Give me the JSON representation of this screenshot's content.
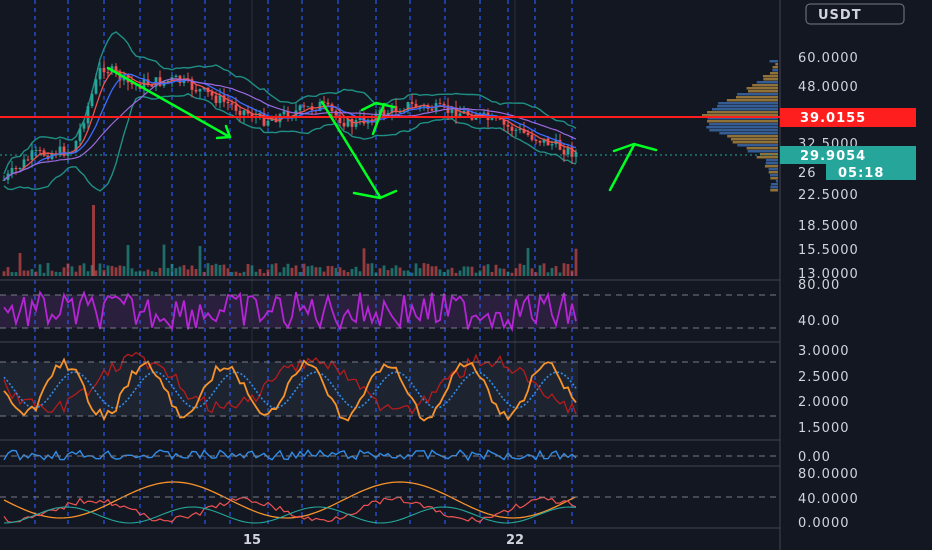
{
  "currency_label": "USDT",
  "price_axis": [
    "60.0000",
    "48.0000",
    "32.5000",
    "26",
    "22.5000",
    "18.5000",
    "15.5000",
    "13.0000"
  ],
  "rsi_axis": [
    "80.00",
    "40.00"
  ],
  "stoch_axis": [
    "3.0000",
    "2.5000",
    "2.0000",
    "1.5000"
  ],
  "mid_axis": [
    "0.00"
  ],
  "dmi_axis": [
    "80.0000",
    "40.0000",
    "0.0000"
  ],
  "badges": {
    "red_price": "39.0155",
    "current_price": "29.9054",
    "countdown": "05:18"
  },
  "date_labels": [
    "15",
    "22"
  ],
  "colors": {
    "background": "#131722",
    "grid_blue": "#2962ff",
    "candle_up": "#26a69a",
    "candle_down": "#ef5350",
    "annotation": "#00ff22",
    "level_red": "#ff1e1e",
    "rsi": "#b525d6",
    "stoch_k": "#f7932b",
    "stoch_d": "#2f8ce8"
  }
}
